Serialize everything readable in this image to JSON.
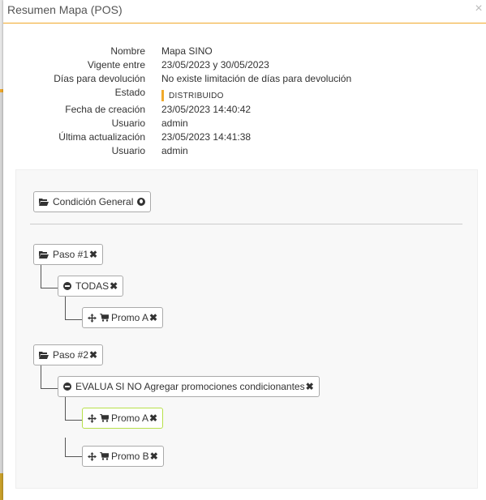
{
  "modal": {
    "title": "Resumen Mapa (POS)",
    "close": "×"
  },
  "details": [
    {
      "label": "Nombre",
      "value": "Mapa SINO"
    },
    {
      "label": "Vigente entre",
      "value": "23/05/2023 y 30/05/2023"
    },
    {
      "label": "Días para devolución",
      "value": "No existe limitación de días para devolución"
    },
    {
      "label": "Estado",
      "value": "DISTRIBUIDO"
    },
    {
      "label": "Fecha de creación",
      "value": "23/05/2023 14:40:42"
    },
    {
      "label": "Usuario",
      "value": "admin"
    },
    {
      "label": "Última actualización",
      "value": "23/05/2023 14:41:38"
    },
    {
      "label": "Usuario",
      "value": "admin"
    }
  ],
  "colors": {
    "accent": "#f0a92a",
    "highlight_border": "#b7e04a"
  },
  "tree": {
    "general": {
      "label": "Condición General",
      "icons": [
        "folder-open-icon",
        "globe-icon"
      ]
    },
    "steps": [
      {
        "label": "Paso #1",
        "condition": {
          "label": "TODAS"
        },
        "promos": [
          {
            "label": "Promo A",
            "highlighted": false
          }
        ]
      },
      {
        "label": "Paso #2",
        "condition": {
          "label": "EVALUA SI NO Agregar promociones condicionantes"
        },
        "promos": [
          {
            "label": "Promo A",
            "highlighted": true
          },
          {
            "label": "Promo B",
            "highlighted": false
          }
        ]
      }
    ]
  }
}
